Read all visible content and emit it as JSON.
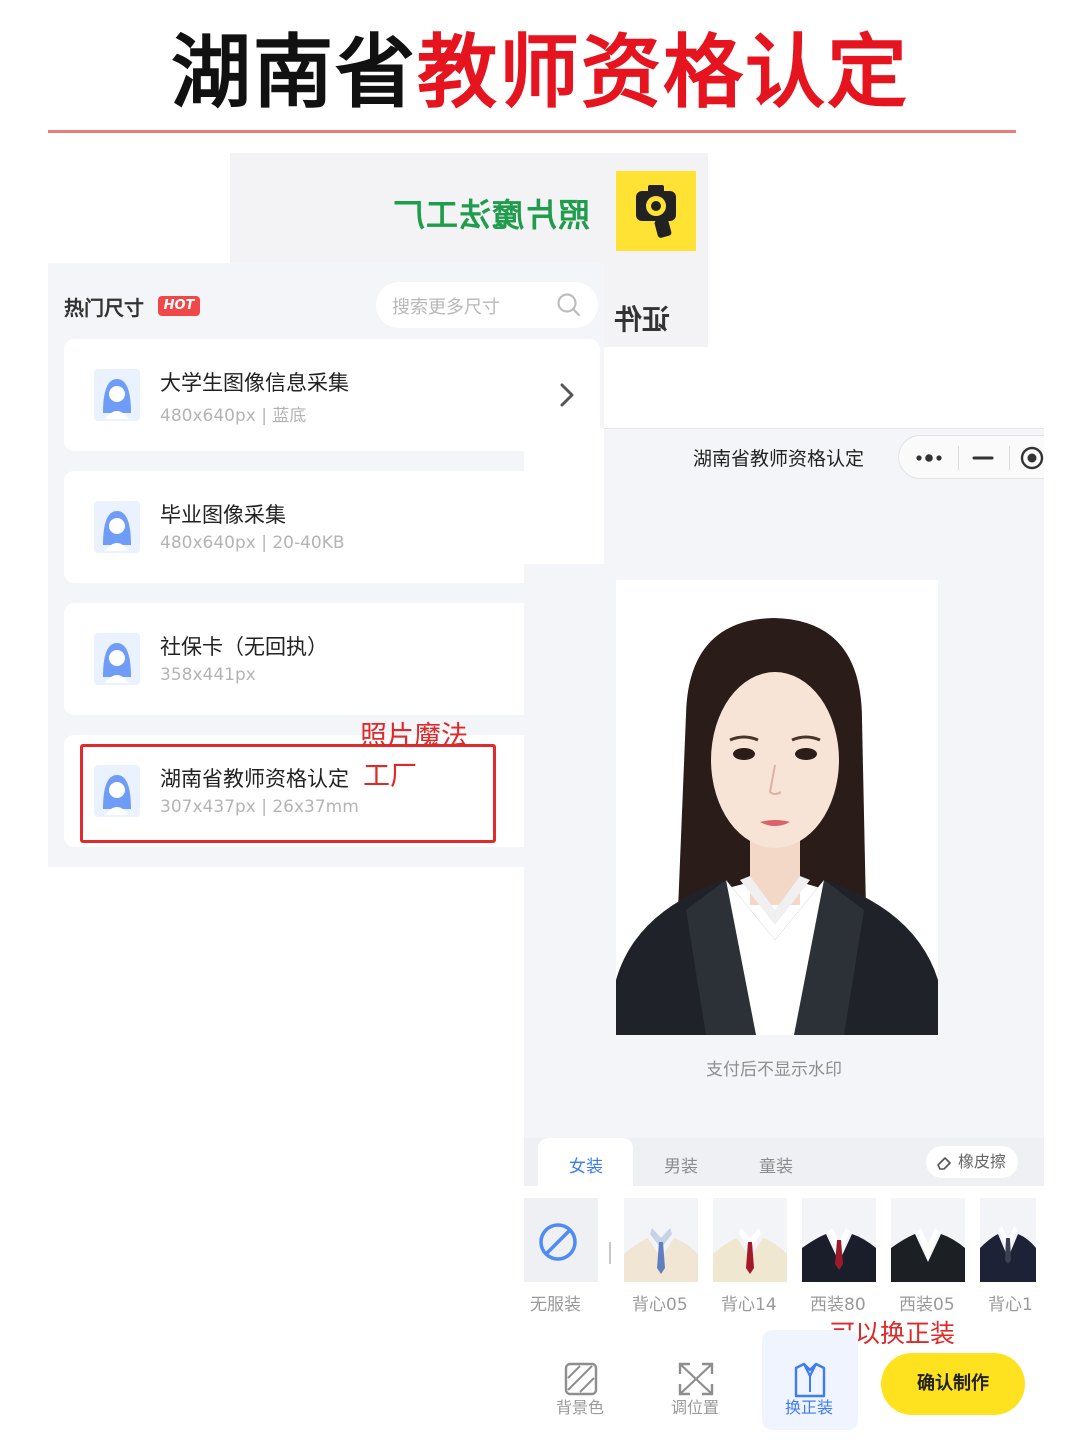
{
  "headline": {
    "part_black": "湖南省",
    "part_red": "教师资格认定"
  },
  "banner": {
    "app_name_mirrored": "照片魔法工厂",
    "side_mirrored": "证件"
  },
  "hot_sizes": {
    "title": "热门尺寸",
    "badge": "HOT",
    "search_placeholder": "搜索更多尺寸",
    "items": [
      {
        "name": "大学生图像信息采集",
        "spec": "480x640px | 蓝底"
      },
      {
        "name": "毕业图像采集",
        "spec": "480x640px | 20-40KB"
      },
      {
        "name": "社保卡（无回执）",
        "spec": "358x441px"
      },
      {
        "name": "湖南省教师资格认定",
        "spec": "307x437px | 26x37mm"
      }
    ]
  },
  "annotations": {
    "app_line1": "照片魔法",
    "app_line2": "工厂",
    "formal_wear": "可以换正装"
  },
  "editor": {
    "title": "湖南省教师资格认定",
    "watermark_note": "支付后不显示水印",
    "tabs": [
      {
        "label": "女装",
        "active": true
      },
      {
        "label": "男装",
        "active": false
      },
      {
        "label": "童装",
        "active": false
      }
    ],
    "eraser_label": "橡皮擦",
    "outfits": [
      {
        "label": "无服装"
      },
      {
        "label": "背心05"
      },
      {
        "label": "背心14"
      },
      {
        "label": "西装80"
      },
      {
        "label": "西装05"
      },
      {
        "label": "背心1"
      }
    ],
    "toolbar": [
      {
        "label": "背景色",
        "icon": "background-color-icon"
      },
      {
        "label": "调位置",
        "icon": "adjust-position-icon"
      },
      {
        "label": "换正装",
        "icon": "change-outfit-icon",
        "active": true
      }
    ],
    "confirm_label": "确认制作"
  },
  "colors": {
    "accent_red": "#e5141f",
    "accent_blue": "#3d7cf7",
    "confirm_yellow": "#ffe21f",
    "logo_yellow": "#ffe234",
    "banner_green": "#1f9c4c"
  }
}
